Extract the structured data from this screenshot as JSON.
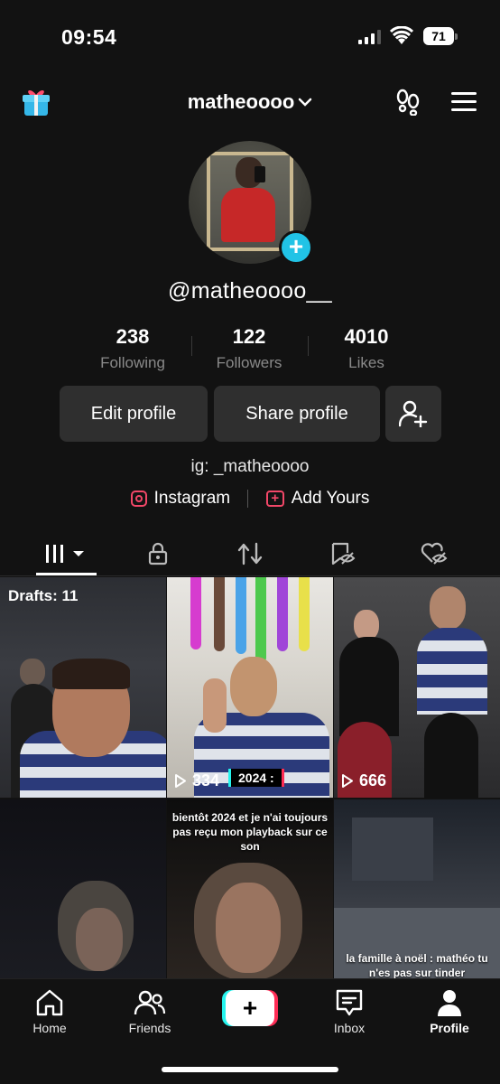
{
  "status_bar": {
    "time": "09:54",
    "battery": "71"
  },
  "header": {
    "username": "matheoooo"
  },
  "profile": {
    "handle": "@matheoooo__",
    "stats": [
      {
        "value": "238",
        "label": "Following"
      },
      {
        "value": "122",
        "label": "Followers"
      },
      {
        "value": "4010",
        "label": "Likes"
      }
    ],
    "edit_label": "Edit profile",
    "share_label": "Share profile",
    "bio": "ig: _matheoooo",
    "links": [
      {
        "label": "Instagram",
        "icon": "instagram-icon"
      },
      {
        "label": "Add Yours",
        "icon": "add-yours-icon"
      }
    ]
  },
  "tabs": [
    {
      "icon": "grid-icon",
      "active": true
    },
    {
      "icon": "lock-icon"
    },
    {
      "icon": "repost-icon"
    },
    {
      "icon": "hidden-bookmark-icon"
    },
    {
      "icon": "hidden-heart-icon"
    }
  ],
  "videos": [
    {
      "overlay": "Drafts: 11"
    },
    {
      "views": "334",
      "badge": "2024 :"
    },
    {
      "views": "666"
    },
    {
      "caption": ""
    },
    {
      "caption": "bientôt 2024 et je n'ai toujours pas reçu mon playback sur ce son"
    },
    {
      "caption": "la famille à noël : mathéo tu n'es pas sur tinder"
    }
  ],
  "nav": [
    {
      "label": "Home",
      "icon": "home-icon"
    },
    {
      "label": "Friends",
      "icon": "friends-icon"
    },
    {
      "label": "",
      "icon": "create-icon"
    },
    {
      "label": "Inbox",
      "icon": "inbox-icon"
    },
    {
      "label": "Profile",
      "icon": "profile-icon",
      "active": true
    }
  ],
  "colors": {
    "accent_cyan": "#25f4ee",
    "accent_pink": "#fe2c55",
    "plus_badge": "#21c3e6",
    "link_icon": "#f24768"
  }
}
